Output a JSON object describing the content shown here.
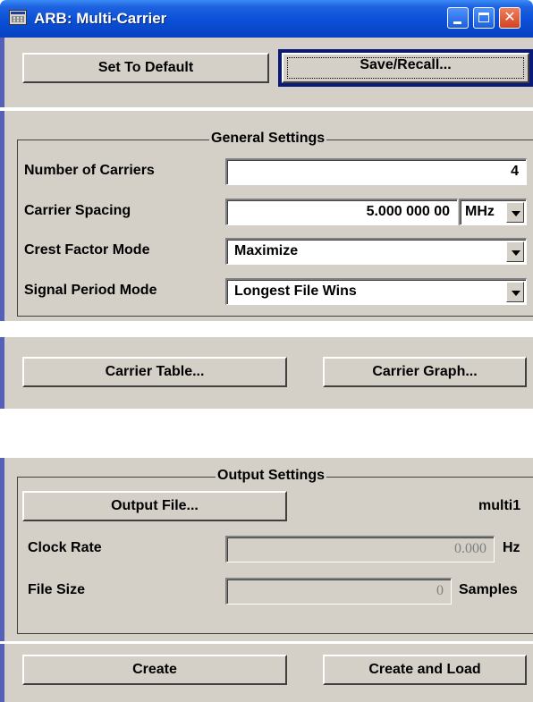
{
  "window": {
    "title": "ARB: Multi-Carrier"
  },
  "toolbar": {
    "set_default_label": "Set To Default",
    "save_recall_label": "Save/Recall..."
  },
  "general": {
    "legend": "General Settings",
    "num_carriers_label": "Number of Carriers",
    "num_carriers_value": "4",
    "spacing_label": "Carrier Spacing",
    "spacing_value": "5.000 000 00",
    "spacing_unit": "MHz",
    "crest_label": "Crest Factor Mode",
    "crest_value": "Maximize",
    "period_label": "Signal Period Mode",
    "period_value": "Longest File Wins"
  },
  "carrier": {
    "table_label": "Carrier Table...",
    "graph_label": "Carrier Graph..."
  },
  "output": {
    "legend": "Output Settings",
    "file_button": "Output File...",
    "file_name": "multi1",
    "clock_label": "Clock Rate",
    "clock_value": "0.000",
    "clock_unit": "Hz",
    "size_label": "File Size",
    "size_value": "0",
    "size_unit": "Samples"
  },
  "actions": {
    "create_label": "Create",
    "create_load_label": "Create and Load"
  },
  "colors": {
    "titlebar": "#0a4fd6",
    "panel": "#d4d0c8",
    "accent_bar": "#5560b8",
    "focus": "#0a1a7a"
  }
}
